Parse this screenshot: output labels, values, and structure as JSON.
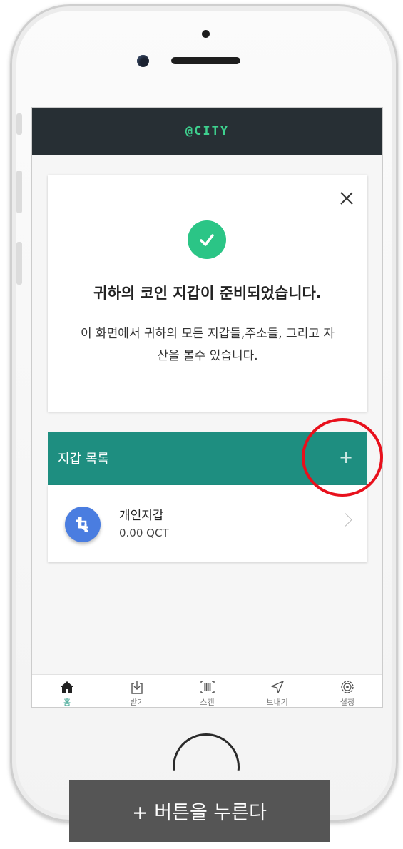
{
  "app": {
    "logo": "@CITY"
  },
  "success_card": {
    "title": "귀하의 코인 지갑이 준비되었습니다.",
    "description": "이 화면에서 귀하의 모든 지갑들,주소들, 그리고 자산을 볼수 있습니다."
  },
  "wallet_list": {
    "title": "지갑 목록",
    "add_label": "+",
    "items": [
      {
        "name": "개인지갑",
        "balance": "0.00 QCT"
      }
    ]
  },
  "bottom_nav": {
    "items": [
      {
        "label": "홈",
        "icon": "home-icon",
        "active": true
      },
      {
        "label": "받기",
        "icon": "receive-icon",
        "active": false
      },
      {
        "label": "스캔",
        "icon": "scan-icon",
        "active": false
      },
      {
        "label": "보내기",
        "icon": "send-icon",
        "active": false
      },
      {
        "label": "설정",
        "icon": "settings-icon",
        "active": false
      }
    ]
  },
  "caption": "+ 버튼을 누른다",
  "colors": {
    "topbar": "#272f34",
    "logo": "#3ed08e",
    "accent": "#1e8e80",
    "success": "#2bc586",
    "annotation": "#e8101c"
  }
}
